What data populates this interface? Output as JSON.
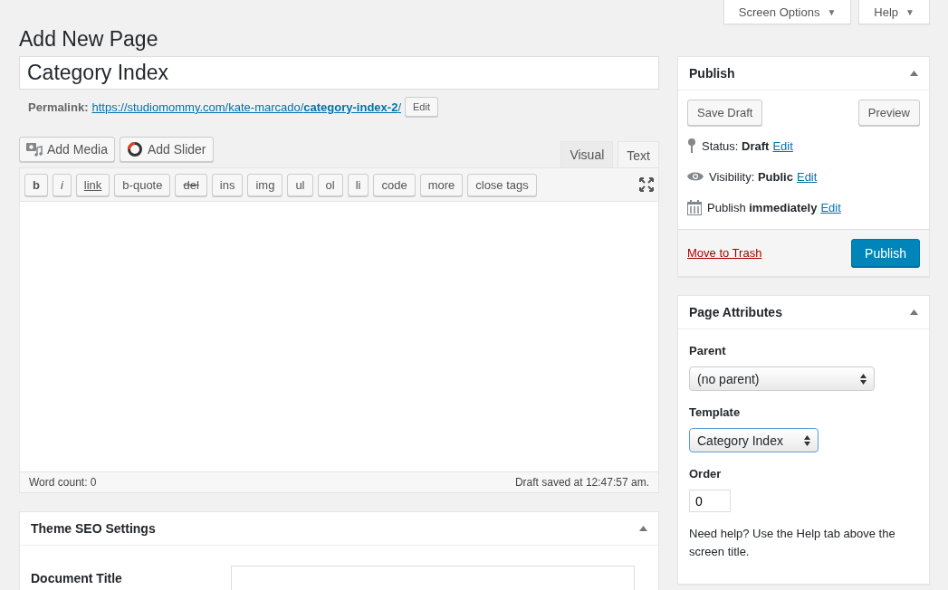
{
  "screen_meta": {
    "buttons": [
      {
        "label": "Screen Options",
        "caret": "▼"
      },
      {
        "label": "Help",
        "caret": "▼"
      }
    ]
  },
  "page_title": "Add New Page",
  "post_title": {
    "value": "Category Index"
  },
  "permalink": {
    "label": "Permalink:",
    "url": "https://studiomommy.com/kate-marcado/**category-index-2**/",
    "edit": "Edit"
  },
  "media_buttons": [
    {
      "label": "Add Media",
      "kind": "media"
    },
    {
      "label": "Add Slider",
      "kind": "slider"
    }
  ],
  "editor_tabs": [
    {
      "label": "Visual",
      "selected": false
    },
    {
      "label": "Text",
      "selected": true
    }
  ],
  "quicktags": [
    {
      "label": "b",
      "kind": "bold"
    },
    {
      "label": "i",
      "kind": "italic"
    },
    {
      "label": "link",
      "kind": "link"
    },
    {
      "label": "b-quote",
      "kind": "plain"
    },
    {
      "label": "del",
      "kind": "strike"
    },
    {
      "label": "ins",
      "kind": "plain"
    },
    {
      "label": "img",
      "kind": "plain"
    },
    {
      "label": "ul",
      "kind": "plain"
    },
    {
      "label": "ol",
      "kind": "plain"
    },
    {
      "label": "li",
      "kind": "plain"
    },
    {
      "label": "code",
      "kind": "plain"
    },
    {
      "label": "more",
      "kind": "plain"
    },
    {
      "label": "close tags",
      "kind": "plain"
    }
  ],
  "editor_status": {
    "word_count": "Word count: 0",
    "draft_saved": "Draft saved at 12:47:57 am."
  },
  "seo_box": {
    "title": "Theme SEO Settings",
    "fields": [
      {
        "label": "Document Title"
      }
    ]
  },
  "publish_box": {
    "title": "Publish",
    "save_draft": "Save Draft",
    "preview": "Preview",
    "rows": [
      {
        "kind": "status",
        "text": "Status: **Draft**",
        "edit": "Edit"
      },
      {
        "kind": "visibility",
        "text": "Visibility: **Public**",
        "edit": "Edit"
      },
      {
        "kind": "schedule",
        "text": "Publish **immediately**",
        "edit": "Edit"
      }
    ],
    "trash": "Move to Trash",
    "publish": "Publish"
  },
  "attributes_box": {
    "title": "Page Attributes",
    "parent_label": "Parent",
    "parent_value": "(no parent)",
    "template_label": "Template",
    "template_value": "Category Index",
    "order_label": "Order",
    "order_value": "0",
    "help": "Need help? Use the Help tab above the screen title."
  }
}
